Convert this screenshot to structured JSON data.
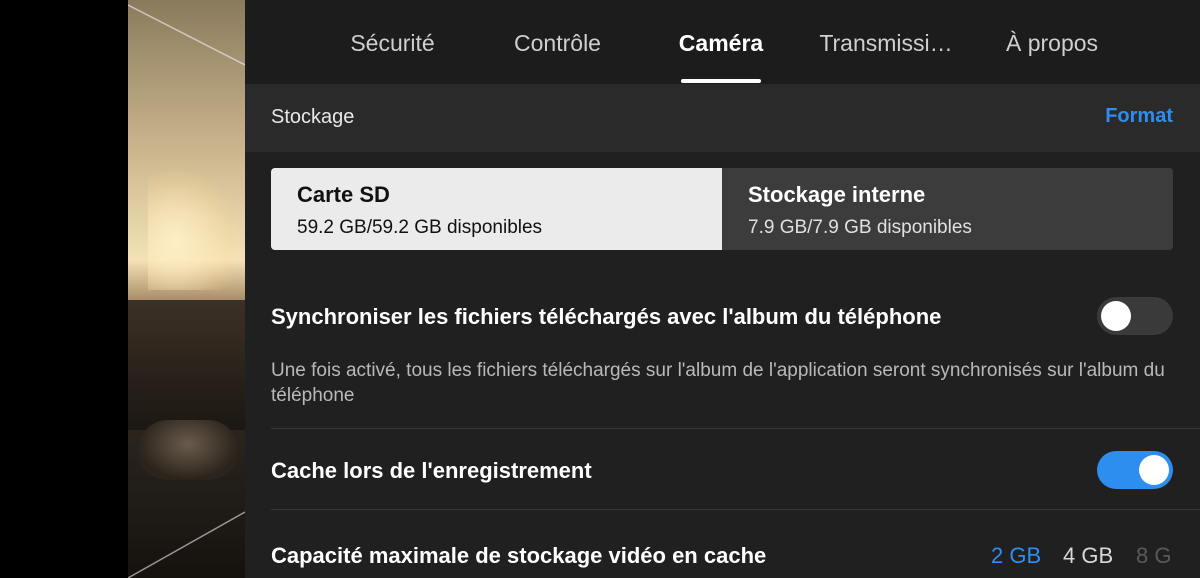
{
  "tabs": [
    {
      "label": "Sécurité"
    },
    {
      "label": "Contrôle"
    },
    {
      "label": "Caméra"
    },
    {
      "label": "Transmissi…"
    },
    {
      "label": "À propos"
    }
  ],
  "active_tab": "Caméra",
  "storage": {
    "title": "Stockage",
    "format_label": "Format",
    "options": [
      {
        "name": "Carte SD",
        "available": "59.2 GB/59.2 GB disponibles",
        "selected": true
      },
      {
        "name": "Stockage interne",
        "available": "7.9 GB/7.9 GB disponibles",
        "selected": false
      }
    ]
  },
  "sync": {
    "title": "Synchroniser les fichiers téléchargés avec l'album du téléphone",
    "enabled": false,
    "description": "Une fois activé, tous les fichiers téléchargés sur l'album de l'application seront synchronisés sur l'album du téléphone"
  },
  "cache": {
    "title": "Cache lors de l'enregistrement",
    "enabled": true
  },
  "cache_capacity": {
    "title": "Capacité maximale de stockage vidéo en cache",
    "options": [
      "2 GB",
      "4 GB",
      "8 G"
    ],
    "selected": "2 GB"
  },
  "colors": {
    "accent": "#2d8ef0",
    "panel_bg": "#202020",
    "header_bg": "#2a2a2a"
  }
}
